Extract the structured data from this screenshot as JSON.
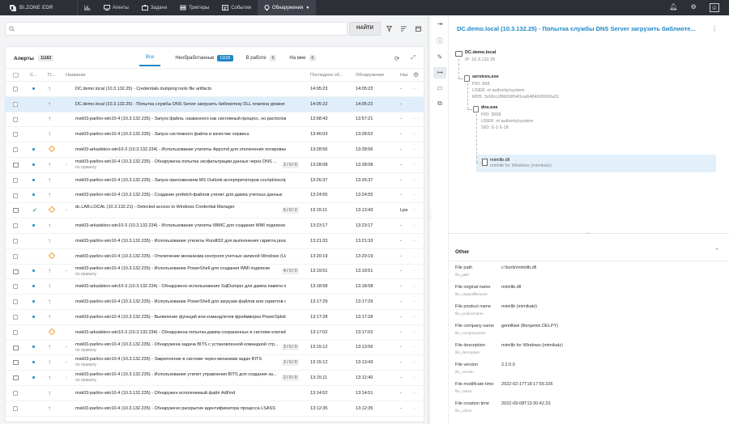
{
  "app": {
    "brand": "BI.ZONE EDR"
  },
  "nav": [
    {
      "label": "",
      "icon": "chart-icon"
    },
    {
      "label": "Агенты",
      "icon": "monitor-icon"
    },
    {
      "label": "Задачи",
      "icon": "briefcase-icon"
    },
    {
      "label": "Триггеры",
      "icon": "trigger-icon"
    },
    {
      "label": "События",
      "icon": "events-icon"
    },
    {
      "label": "Обнаружения",
      "icon": "bulb-icon",
      "active": true
    }
  ],
  "search": {
    "placeholder": "",
    "find_label": "НАЙТИ"
  },
  "alerts": {
    "title": "Алерты",
    "count": "11162",
    "tabs": [
      {
        "label": "Все",
        "badge": "",
        "active": true
      },
      {
        "label": "Необработанные",
        "badge": "11165"
      },
      {
        "label": "В работе",
        "badge": "0"
      },
      {
        "label": "На мне",
        "badge": "0"
      }
    ],
    "columns": {
      "status": "С...",
      "priority": "П...",
      "name": "Название",
      "last": "Последнее об...",
      "discovered": "Обнаружение",
      "nas": "Наз"
    },
    "rows": [
      {
        "st": "dot",
        "pr": "up",
        "name": "DC.demo.local (10.3.132.25) - Credentials dumping tools file artifacts",
        "last": "14:05:23",
        "disc": "14:05:23",
        "nas": "-"
      },
      {
        "st": "",
        "pr": "up",
        "name": "DC.demo.local (10.3.132.25) - Попытка службы DNS Server загрузить библиотеку DLL плагина уровня сервер...",
        "last": "14:05:22",
        "disc": "14:05:22",
        "nas": "-",
        "sel": true
      },
      {
        "st": "",
        "pr": "up",
        "name": "msk03-parilov-win10-4 (10.3.132.235) - Запуск файла, названного как системный процесс, но расположен...",
        "last": "13:58:43",
        "disc": "13:57:21",
        "nas": "-"
      },
      {
        "st": "",
        "pr": "up",
        "name": "msk03-parilov-win10-4 (10.3.132.235) - Запуск системного файла в качестве сервиса",
        "last": "13:46:03",
        "disc": "13:28:52",
        "nas": "-"
      },
      {
        "st": "dot",
        "pr": "diamond",
        "name": "msk03-arkadskov-win10-3 (10.3.132.234) - Использование утилиты Appcmd для отключения логировани...",
        "last": "13:28:56",
        "disc": "13:28:56",
        "nas": "-"
      },
      {
        "st": "dot",
        "pr": "up",
        "group": true,
        "name": "msk03-parilov-win10-4 (10.3.132.235) - Обнаружена попытка эксфильтрации данных через DNS ...",
        "sub": "по правилу",
        "cnt": "2 / 0 / 0",
        "last": "13:28:08",
        "disc": "13:28:08",
        "nas": "-"
      },
      {
        "st": "dot",
        "pr": "up",
        "name": "msk03-parilov-win10-4 (10.3.132.235) - Запуск приложением MS Outlook интерпретаторов cscript/wscript",
        "last": "13:26:37",
        "disc": "13:26:37",
        "nas": "-"
      },
      {
        "st": "dot",
        "pr": "up",
        "name": "msk03-parilov-win10-4 (10.3.132.235) - Создание prefetch-файлов утилит для дампа учетных данных",
        "last": "13:24:55",
        "disc": "13:24:55",
        "nas": "-"
      },
      {
        "st": "check",
        "pr": "diamond",
        "group": true,
        "name": "dc.LAB.LOCAL (10.3.132.21) - Detected access to Windows Credential Manager",
        "sub": "",
        "cnt": "6 / 0 / 2",
        "last": "13:15:11",
        "disc": "13:13:43",
        "nas": "Lpa"
      },
      {
        "st": "dot",
        "pr": "up",
        "name": "msk03-arkadskov-win10-3 (10.3.132.234) - Использование утилиты WMIC для создания WMI подписки",
        "last": "13:23:17",
        "disc": "13:23:17",
        "nas": "-"
      },
      {
        "st": "",
        "pr": "up",
        "name": "msk03-parilov-win10-4 (10.3.132.235) - Использование утилиты Rundll32 для выполнения скрипта javascri...",
        "last": "13:21:33",
        "disc": "13:21:33",
        "nas": "-"
      },
      {
        "st": "",
        "pr": "diamond",
        "name": "msk03-parilov-win10-4 (10.3.132.235) - Отключение механизма контроля учетных записей Windows (UAC)",
        "last": "13:20:19",
        "disc": "13:20:19",
        "nas": "-"
      },
      {
        "st": "dot",
        "pr": "up",
        "group": true,
        "name": "msk03-parilov-win10-4 (10.3.132.235) - Использование PowerShell для создания WMI подписки",
        "sub": "по правилу",
        "cnt": "4 / 0 / 0",
        "last": "13:19:51",
        "disc": "13:19:51",
        "nas": "-"
      },
      {
        "st": "dot",
        "pr": "up",
        "name": "msk03-arkadskov-win10-3 (10.3.132.234) - Обнаружено использование SqlDumper для дампа памяти проц...",
        "last": "13:18:58",
        "disc": "13:18:58",
        "nas": "-"
      },
      {
        "st": "dot",
        "pr": "up",
        "name": "msk03-parilov-win10-4 (10.3.132.235) - Использование PowerShell для загрузки файлов или скриптов с ин...",
        "last": "13:17:29",
        "disc": "13:17:29",
        "nas": "-"
      },
      {
        "st": "dot",
        "pr": "up",
        "name": "msk03-parilov-win10-4 (10.3.132.235) - Выявление функций или командлетов фреймворка PowerSploit",
        "last": "13:17:28",
        "disc": "13:17:28",
        "nas": "-"
      },
      {
        "st": "",
        "pr": "diamond",
        "name": "msk03-arkadskov-win10-3 (10.3.132.234) - Обнаружена попытка дампа сохраненных в системе ключей PS...",
        "last": "13:17:02",
        "disc": "13:17:02",
        "nas": "-"
      },
      {
        "st": "dot",
        "pr": "up",
        "group": true,
        "name": "msk03-parilov-win10-4 (10.3.132.235) - Обнаружена задача BITS с установленной командной стр...",
        "sub": "по правилу",
        "cnt": "2 / 0 / 0",
        "last": "13:15:12",
        "disc": "13:13:56",
        "nas": "-"
      },
      {
        "st": "dot",
        "pr": "up",
        "group": true,
        "name": "msk03-parilov-win10-4 (10.3.132.235) - Закрепление в системе через механизм задач BITS",
        "sub": "по правилу",
        "cnt": "2 / 0 / 0",
        "last": "13:15:12",
        "disc": "13:13:43",
        "nas": "-"
      },
      {
        "st": "dot",
        "pr": "up",
        "group": true,
        "name": "msk03-parilov-win10-4 (10.3.132.235) - Использование утилит управления BITS для создания за...",
        "sub": "по правилу",
        "cnt": "2 / 0 / 0",
        "last": "13:15:11",
        "disc": "13:12:40",
        "nas": "-"
      },
      {
        "st": "",
        "pr": "up",
        "name": "msk03-parilov-win10-4 (10.3.132.235) - Обнаружен исполняемый файл AdFind",
        "last": "13:14:52",
        "disc": "13:14:51",
        "nas": "-"
      },
      {
        "st": "",
        "pr": "up",
        "name": "msk03-parilov-win10-4 (10.3.132.235) - Обнаружено раскрытие идентификатора процесса LSASS",
        "last": "13:12:35",
        "disc": "13:12:35",
        "nas": "-"
      }
    ]
  },
  "detail": {
    "title": "DC.demo.local (10.3.132.25) - Попытка службы DNS Server загрузить библиоте...",
    "tree": {
      "host": {
        "name": "DC.demo.local",
        "ip": "IP: 10.3.132.25"
      },
      "p1": {
        "name": "services.exe",
        "pid": "PID: 668",
        "user": "USER: nt authority\\system",
        "md5": "MD5: 3c69cc28665854f1ea6484005009a31"
      },
      "p2": {
        "name": "dns.exe",
        "pid": "PID: 3068",
        "user": "USER: nt authority\\system",
        "sid": "SID: S-1-5-18"
      },
      "file": {
        "name": "mimilib.dll",
        "desc": "mimilib for Windows (mimikatz)"
      }
    },
    "other_title": "Other",
    "props": [
      {
        "k": "File path",
        "kk": "file_path",
        "v": "c:\\tools\\mimilib.dll"
      },
      {
        "k": "File original name",
        "kk": "file_originalfilename",
        "v": "mimilib.dll"
      },
      {
        "k": "File product name",
        "kk": "file_productname",
        "v": "mimilib (mimikatz)"
      },
      {
        "k": "File company name",
        "kk": "file_companyname",
        "v": "gentilkiwi (Benjamin DELPY)"
      },
      {
        "k": "File description",
        "kk": "file_description",
        "v": "mimilib for Windows (mimikatz)"
      },
      {
        "k": "File version",
        "kk": "file_version",
        "v": "2.2.0.0"
      },
      {
        "k": "File modificate time",
        "kk": "file_mtime",
        "v": "2022-02-17T18:17:59.326"
      },
      {
        "k": "File creation time",
        "kk": "file_crtime",
        "v": "2022-09-08T13:30:42.33"
      }
    ]
  },
  "colors": {
    "accent": "#1e88c7",
    "danger": "#e0454a",
    "warn": "#f0a030",
    "ok": "#4caf50"
  }
}
